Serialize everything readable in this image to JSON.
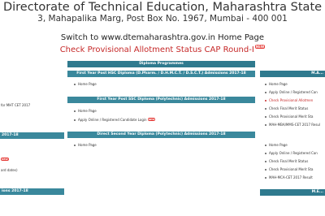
{
  "header": {
    "title": "Directorate of Technical Education, Maharashtra State",
    "address": "3, Mahapalika Marg, Post Box No. 1967, Mumbai - 400 001"
  },
  "switch_text": "Switch to www.dtemaharashtra.gov.in Home Page",
  "status_text": "Check Provisional Allotment Status CAP Round-I",
  "new_label": "NEW",
  "left": {
    "text1": "for MHT CET 2017",
    "bar1": "2017-18",
    "text2": "ard dates)",
    "bar2": "ions 2017-18"
  },
  "mid": {
    "header": "Diploma Programmes",
    "sections": [
      {
        "title": "First Year Post HSC Diploma (D.Pharm. / D.H.M.C.T. / D.S.C.T.) Admissions 2017-18",
        "items": [
          "Home Page"
        ]
      },
      {
        "title": "First Year Post SSC Diploma (Polytechnic) Admissions 2017-18",
        "items": [
          "Home Page",
          "Apply Online / Registered Candidate Login"
        ]
      },
      {
        "title": "Direct Second Year Diploma (Polytechnic) Admissions 2017-18",
        "items": [
          "Home Page"
        ]
      }
    ]
  },
  "right": {
    "header": "M.A...",
    "top_items": [
      "Home Page",
      "Apply Online / Registered Can",
      "Check Provisional Allotmen",
      "Check Final Merit Status",
      "Check Provisional Merit Sta",
      "MAH-MBA/MMS-CET 2017 Resul"
    ],
    "bottom_items": [
      "Home Page",
      "Apply Online / Registered Can",
      "Check Final Merit Status",
      "Check Provisional Merit Sta",
      "MAH-MCA-CET 2017 Result"
    ],
    "bottom_header": "M.E..."
  }
}
